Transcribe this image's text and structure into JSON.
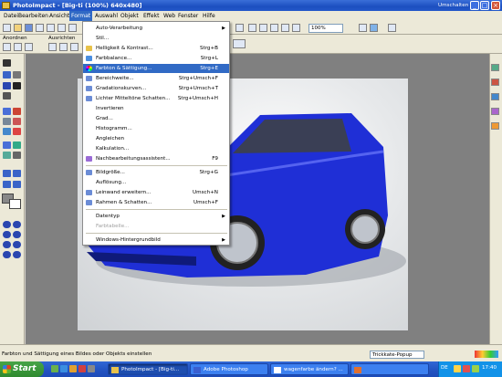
{
  "window": {
    "title": "PhotoImpact - [Big-ti (100%) 640x480]",
    "unschalten_label": "Umschalten",
    "min": "_",
    "max": "□",
    "close": "×"
  },
  "menubar": {
    "items": [
      "Datei",
      "Bearbeiten",
      "Ansicht",
      "Format",
      "Auswahl",
      "Objekt",
      "Effekt",
      "Web",
      "Fenster",
      "Hilfe"
    ]
  },
  "toolbar": {
    "anordnen_label": "Anordnen",
    "ausrichten_label": "Ausrichten",
    "zoom_value": "100%"
  },
  "format_menu": {
    "items": [
      {
        "label": "Auto-Verarbeitung",
        "shortcut": "",
        "submenu": true
      },
      {
        "label": "Stil...",
        "shortcut": ""
      },
      {
        "label": "Helligkeit & Kontrast...",
        "shortcut": "Strg+B"
      },
      {
        "label": "Farbbalance...",
        "shortcut": "Strg+L"
      },
      {
        "label": "Farbton & Sättigung...",
        "shortcut": "Strg+E",
        "highlighted": true
      },
      {
        "label": "Bereichweite...",
        "shortcut": "Strg+Umsch+F"
      },
      {
        "label": "Gradationskurven...",
        "shortcut": "Strg+Umsch+T"
      },
      {
        "label": "Lichter Mitteltöne Schatten...",
        "shortcut": "Strg+Umsch+H"
      },
      {
        "label": "Invertieren",
        "shortcut": ""
      },
      {
        "label": "Grad...",
        "shortcut": ""
      },
      {
        "label": "Histogramm...",
        "shortcut": ""
      },
      {
        "label": "Angleichen",
        "shortcut": ""
      },
      {
        "label": "Kalkulation...",
        "shortcut": ""
      },
      {
        "label": "Nachbearbeitungsassistent...",
        "shortcut": "F9"
      },
      {
        "label": "Bildgröße...",
        "shortcut": "Strg+G"
      },
      {
        "label": "Auflösung...",
        "shortcut": ""
      },
      {
        "label": "Leinwand erweitern...",
        "shortcut": "Umsch+N"
      },
      {
        "label": "Rahmen & Schatten...",
        "shortcut": "Umsch+F"
      },
      {
        "label": "Datentyp",
        "shortcut": "",
        "submenu": true
      },
      {
        "label": "Farbtabelle...",
        "shortcut": "",
        "disabled": true
      },
      {
        "label": "Windows-Hintergrundbild",
        "shortcut": "",
        "submenu": true
      }
    ]
  },
  "statusbar": {
    "text": "Farbton und Sättigung eines Bildes oder Objekts einstellen",
    "trick_select": "Trickkate-Popup"
  },
  "taskbar": {
    "start_label": "Start",
    "tasks": [
      {
        "label": "PhotoImpact - [Big-ti...",
        "active": true
      },
      {
        "label": "Adobe Photoshop",
        "active": false
      },
      {
        "label": "wagenfarbe ändern? ...",
        "active": false
      },
      {
        "label": "",
        "active": false
      }
    ],
    "lang": "DE",
    "clock": "17:40"
  },
  "colors": {
    "titlebar": "#1c4fc0",
    "highlight": "#316ac5",
    "car_blue": "#1f2fd6",
    "taskbar": "#2455c3",
    "start_green": "#47a447"
  }
}
